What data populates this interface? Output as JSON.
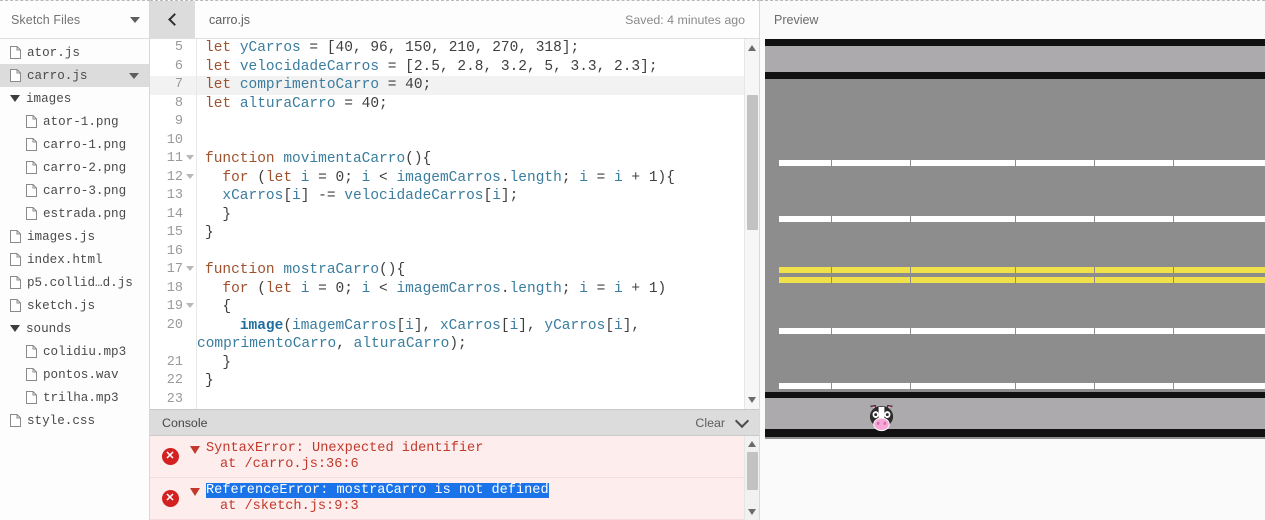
{
  "sidebar": {
    "header_title": "Sketch Files",
    "header_caret_icon": "chevron-down-icon",
    "items": [
      {
        "label": "ator.js",
        "type": "file",
        "indent": 0,
        "selected": false,
        "icon": "file-icon"
      },
      {
        "label": "carro.js",
        "type": "file",
        "indent": 0,
        "selected": true,
        "icon": "file-icon",
        "caret": "chevron-down-icon"
      },
      {
        "label": "images",
        "type": "folder",
        "indent": 0,
        "selected": false,
        "icon": "folder-open-icon"
      },
      {
        "label": "ator-1.png",
        "type": "file",
        "indent": 1,
        "selected": false,
        "icon": "file-icon"
      },
      {
        "label": "carro-1.png",
        "type": "file",
        "indent": 1,
        "selected": false,
        "icon": "file-icon"
      },
      {
        "label": "carro-2.png",
        "type": "file",
        "indent": 1,
        "selected": false,
        "icon": "file-icon"
      },
      {
        "label": "carro-3.png",
        "type": "file",
        "indent": 1,
        "selected": false,
        "icon": "file-icon"
      },
      {
        "label": "estrada.png",
        "type": "file",
        "indent": 1,
        "selected": false,
        "icon": "file-icon"
      },
      {
        "label": "images.js",
        "type": "file",
        "indent": 0,
        "selected": false,
        "icon": "file-icon"
      },
      {
        "label": "index.html",
        "type": "file",
        "indent": 0,
        "selected": false,
        "icon": "file-icon"
      },
      {
        "label": "p5.collid…d.js",
        "type": "file",
        "indent": 0,
        "selected": false,
        "icon": "file-icon"
      },
      {
        "label": "sketch.js",
        "type": "file",
        "indent": 0,
        "selected": false,
        "icon": "file-icon"
      },
      {
        "label": "sounds",
        "type": "folder",
        "indent": 0,
        "selected": false,
        "icon": "folder-open-icon"
      },
      {
        "label": "colidiu.mp3",
        "type": "file",
        "indent": 1,
        "selected": false,
        "icon": "file-icon"
      },
      {
        "label": "pontos.wav",
        "type": "file",
        "indent": 1,
        "selected": false,
        "icon": "file-icon"
      },
      {
        "label": "trilha.mp3",
        "type": "file",
        "indent": 1,
        "selected": false,
        "icon": "file-icon"
      },
      {
        "label": "style.css",
        "type": "file",
        "indent": 0,
        "selected": false,
        "icon": "file-icon"
      }
    ]
  },
  "editor": {
    "collapse_icon": "chevron-left-icon",
    "filename": "carro.js",
    "saved_status": "Saved: 4 minutes ago",
    "lines": [
      {
        "num": "5",
        "fold": false,
        "highlight": false,
        "tokens": [
          {
            "t": "let",
            "c": "k"
          },
          {
            "t": " ",
            "c": "p"
          },
          {
            "t": "yCarros",
            "c": "v"
          },
          {
            "t": " = [",
            "c": "p"
          },
          {
            "t": "40",
            "c": "n"
          },
          {
            "t": ", ",
            "c": "p"
          },
          {
            "t": "96",
            "c": "n"
          },
          {
            "t": ", ",
            "c": "p"
          },
          {
            "t": "150",
            "c": "n"
          },
          {
            "t": ", ",
            "c": "p"
          },
          {
            "t": "210",
            "c": "n"
          },
          {
            "t": ", ",
            "c": "p"
          },
          {
            "t": "270",
            "c": "n"
          },
          {
            "t": ", ",
            "c": "p"
          },
          {
            "t": "318",
            "c": "n"
          },
          {
            "t": "];",
            "c": "p"
          }
        ]
      },
      {
        "num": "6",
        "fold": false,
        "highlight": false,
        "tokens": [
          {
            "t": "let",
            "c": "k"
          },
          {
            "t": " ",
            "c": "p"
          },
          {
            "t": "velocidadeCarros",
            "c": "v"
          },
          {
            "t": " = [",
            "c": "p"
          },
          {
            "t": "2.5",
            "c": "n"
          },
          {
            "t": ", ",
            "c": "p"
          },
          {
            "t": "2.8",
            "c": "n"
          },
          {
            "t": ", ",
            "c": "p"
          },
          {
            "t": "3.2",
            "c": "n"
          },
          {
            "t": ", ",
            "c": "p"
          },
          {
            "t": "5",
            "c": "n"
          },
          {
            "t": ", ",
            "c": "p"
          },
          {
            "t": "3.3",
            "c": "n"
          },
          {
            "t": ", ",
            "c": "p"
          },
          {
            "t": "2.3",
            "c": "n"
          },
          {
            "t": "];",
            "c": "p"
          }
        ]
      },
      {
        "num": "7",
        "fold": false,
        "highlight": true,
        "tokens": [
          {
            "t": "let",
            "c": "k"
          },
          {
            "t": " ",
            "c": "p"
          },
          {
            "t": "comprimentoCarro",
            "c": "v"
          },
          {
            "t": " = ",
            "c": "p"
          },
          {
            "t": "40",
            "c": "n"
          },
          {
            "t": ";",
            "c": "p"
          }
        ]
      },
      {
        "num": "8",
        "fold": false,
        "highlight": false,
        "tokens": [
          {
            "t": "let",
            "c": "k"
          },
          {
            "t": " ",
            "c": "p"
          },
          {
            "t": "alturaCarro",
            "c": "v"
          },
          {
            "t": " = ",
            "c": "p"
          },
          {
            "t": "40",
            "c": "n"
          },
          {
            "t": ";",
            "c": "p"
          }
        ]
      },
      {
        "num": "9",
        "fold": false,
        "highlight": false,
        "tokens": []
      },
      {
        "num": "10",
        "fold": false,
        "highlight": false,
        "tokens": []
      },
      {
        "num": "11",
        "fold": true,
        "highlight": false,
        "tokens": [
          {
            "t": "function",
            "c": "k"
          },
          {
            "t": " ",
            "c": "p"
          },
          {
            "t": "movimentaCarro",
            "c": "v"
          },
          {
            "t": "(){",
            "c": "p"
          }
        ]
      },
      {
        "num": "12",
        "fold": true,
        "highlight": false,
        "tokens": [
          {
            "t": "  ",
            "c": "p"
          },
          {
            "t": "for",
            "c": "k"
          },
          {
            "t": " (",
            "c": "p"
          },
          {
            "t": "let",
            "c": "k"
          },
          {
            "t": " ",
            "c": "p"
          },
          {
            "t": "i",
            "c": "v"
          },
          {
            "t": " = ",
            "c": "p"
          },
          {
            "t": "0",
            "c": "n"
          },
          {
            "t": "; ",
            "c": "p"
          },
          {
            "t": "i",
            "c": "v"
          },
          {
            "t": " < ",
            "c": "p"
          },
          {
            "t": "imagemCarros",
            "c": "v"
          },
          {
            "t": ".",
            "c": "p"
          },
          {
            "t": "length",
            "c": "v"
          },
          {
            "t": "; ",
            "c": "p"
          },
          {
            "t": "i",
            "c": "v"
          },
          {
            "t": " = ",
            "c": "p"
          },
          {
            "t": "i",
            "c": "v"
          },
          {
            "t": " + ",
            "c": "p"
          },
          {
            "t": "1",
            "c": "n"
          },
          {
            "t": "){",
            "c": "p"
          }
        ]
      },
      {
        "num": "13",
        "fold": false,
        "highlight": false,
        "tokens": [
          {
            "t": "  ",
            "c": "p"
          },
          {
            "t": "xCarros",
            "c": "v"
          },
          {
            "t": "[",
            "c": "p"
          },
          {
            "t": "i",
            "c": "v"
          },
          {
            "t": "] -= ",
            "c": "p"
          },
          {
            "t": "velocidadeCarros",
            "c": "v"
          },
          {
            "t": "[",
            "c": "p"
          },
          {
            "t": "i",
            "c": "v"
          },
          {
            "t": "];",
            "c": "p"
          }
        ]
      },
      {
        "num": "14",
        "fold": false,
        "highlight": false,
        "tokens": [
          {
            "t": "  }",
            "c": "p"
          }
        ]
      },
      {
        "num": "15",
        "fold": false,
        "highlight": false,
        "tokens": [
          {
            "t": "}",
            "c": "p"
          }
        ]
      },
      {
        "num": "16",
        "fold": false,
        "highlight": false,
        "tokens": []
      },
      {
        "num": "17",
        "fold": true,
        "highlight": false,
        "tokens": [
          {
            "t": "function",
            "c": "k"
          },
          {
            "t": " ",
            "c": "p"
          },
          {
            "t": "mostraCarro",
            "c": "v"
          },
          {
            "t": "(){",
            "c": "p"
          }
        ]
      },
      {
        "num": "18",
        "fold": false,
        "highlight": false,
        "tokens": [
          {
            "t": "  ",
            "c": "p"
          },
          {
            "t": "for",
            "c": "k"
          },
          {
            "t": " (",
            "c": "p"
          },
          {
            "t": "let",
            "c": "k"
          },
          {
            "t": " ",
            "c": "p"
          },
          {
            "t": "i",
            "c": "v"
          },
          {
            "t": " = ",
            "c": "p"
          },
          {
            "t": "0",
            "c": "n"
          },
          {
            "t": "; ",
            "c": "p"
          },
          {
            "t": "i",
            "c": "v"
          },
          {
            "t": " < ",
            "c": "p"
          },
          {
            "t": "imagemCarros",
            "c": "v"
          },
          {
            "t": ".",
            "c": "p"
          },
          {
            "t": "length",
            "c": "v"
          },
          {
            "t": "; ",
            "c": "p"
          },
          {
            "t": "i",
            "c": "v"
          },
          {
            "t": " = ",
            "c": "p"
          },
          {
            "t": "i",
            "c": "v"
          },
          {
            "t": " + ",
            "c": "p"
          },
          {
            "t": "1",
            "c": "n"
          },
          {
            "t": ")",
            "c": "p"
          }
        ]
      },
      {
        "num": "19",
        "fold": true,
        "highlight": false,
        "tokens": [
          {
            "t": "  {",
            "c": "p"
          }
        ]
      },
      {
        "num": "20",
        "fold": false,
        "highlight": false,
        "tokens": [
          {
            "t": "    ",
            "c": "p"
          },
          {
            "t": "image",
            "c": "fn"
          },
          {
            "t": "(",
            "c": "p"
          },
          {
            "t": "imagemCarros",
            "c": "v"
          },
          {
            "t": "[",
            "c": "p"
          },
          {
            "t": "i",
            "c": "v"
          },
          {
            "t": "], ",
            "c": "p"
          },
          {
            "t": "xCarros",
            "c": "v"
          },
          {
            "t": "[",
            "c": "p"
          },
          {
            "t": "i",
            "c": "v"
          },
          {
            "t": "], ",
            "c": "p"
          },
          {
            "t": "yCarros",
            "c": "v"
          },
          {
            "t": "[",
            "c": "p"
          },
          {
            "t": "i",
            "c": "v"
          },
          {
            "t": "],",
            "c": "p"
          }
        ]
      },
      {
        "num": "",
        "fold": false,
        "highlight": false,
        "wrap": true,
        "tokens": [
          {
            "t": "comprimentoCarro",
            "c": "v"
          },
          {
            "t": ", ",
            "c": "p"
          },
          {
            "t": "alturaCarro",
            "c": "v"
          },
          {
            "t": ");",
            "c": "p"
          }
        ]
      },
      {
        "num": "21",
        "fold": false,
        "highlight": false,
        "tokens": [
          {
            "t": "  }",
            "c": "p"
          }
        ]
      },
      {
        "num": "22",
        "fold": false,
        "highlight": false,
        "tokens": [
          {
            "t": "}",
            "c": "p"
          }
        ]
      },
      {
        "num": "23",
        "fold": false,
        "highlight": false,
        "tokens": []
      }
    ],
    "scrollbar": {
      "up_icon": "scroll-up-arrow-icon",
      "down_icon": "scroll-down-arrow-icon"
    }
  },
  "console": {
    "title": "Console",
    "clear_label": "Clear",
    "collapse_icon": "chevron-down-icon",
    "messages": [
      {
        "icon": "error-icon",
        "expand_icon": "triangle-down-icon",
        "text": "SyntaxError: Unexpected identifier",
        "location": "at /carro.js:36:6",
        "selected": false
      },
      {
        "icon": "error-icon",
        "expand_icon": "triangle-down-icon",
        "text": "ReferenceError: mostraCarro is not defined",
        "location": "at /sketch.js:9:3",
        "selected": true
      }
    ],
    "scrollbar": {
      "up_icon": "scroll-up-arrow-icon",
      "down_icon": "scroll-down-arrow-icon"
    }
  },
  "preview": {
    "title": "Preview",
    "canvas": {
      "road_color": "#8d8d8d",
      "shoulder_color": "#adaaae",
      "edge_color": "#111111",
      "lane_dash_color": "#ffffff",
      "center_line_color": "#f0e14a",
      "character_icon": "cow-icon"
    }
  }
}
